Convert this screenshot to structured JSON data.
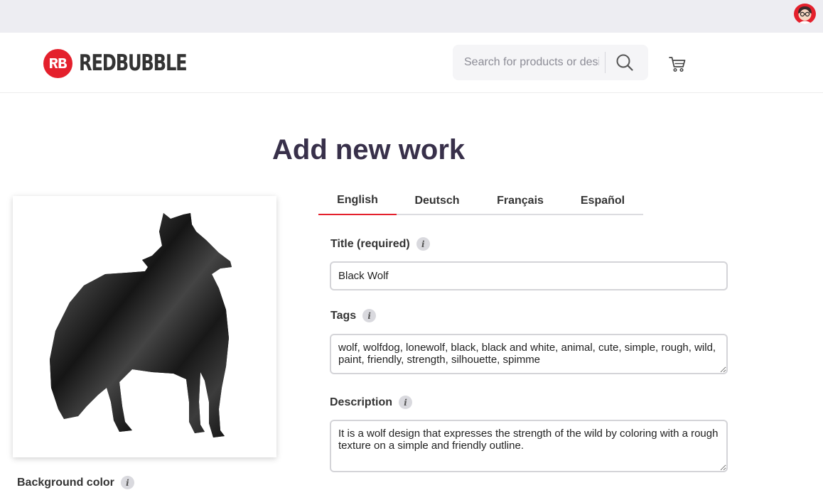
{
  "brand": {
    "name": "REDBUBBLE",
    "color": "#e4202c"
  },
  "search": {
    "placeholder": "Search for products or designs"
  },
  "page": {
    "title": "Add new work"
  },
  "tabs": [
    {
      "label": "English",
      "active": true
    },
    {
      "label": "Deutsch",
      "active": false
    },
    {
      "label": "Français",
      "active": false
    },
    {
      "label": "Español",
      "active": false
    }
  ],
  "form": {
    "title": {
      "label": "Title (required)",
      "value": "Black Wolf"
    },
    "tags": {
      "label": "Tags",
      "value": "wolf, wolfdog, lonewolf, black, black and white, animal, cute, simple, rough, wild, paint, friendly, strength, silhouette, spimme"
    },
    "description": {
      "label": "Description",
      "value": "It is a wolf design that expresses the strength of the wild by coloring with a rough texture on a simple and friendly outline."
    }
  },
  "background_color": {
    "label": "Background color"
  },
  "icons": {
    "info": "i",
    "search": "search-icon",
    "cart": "cart-icon",
    "avatar": "avatar-icon"
  }
}
